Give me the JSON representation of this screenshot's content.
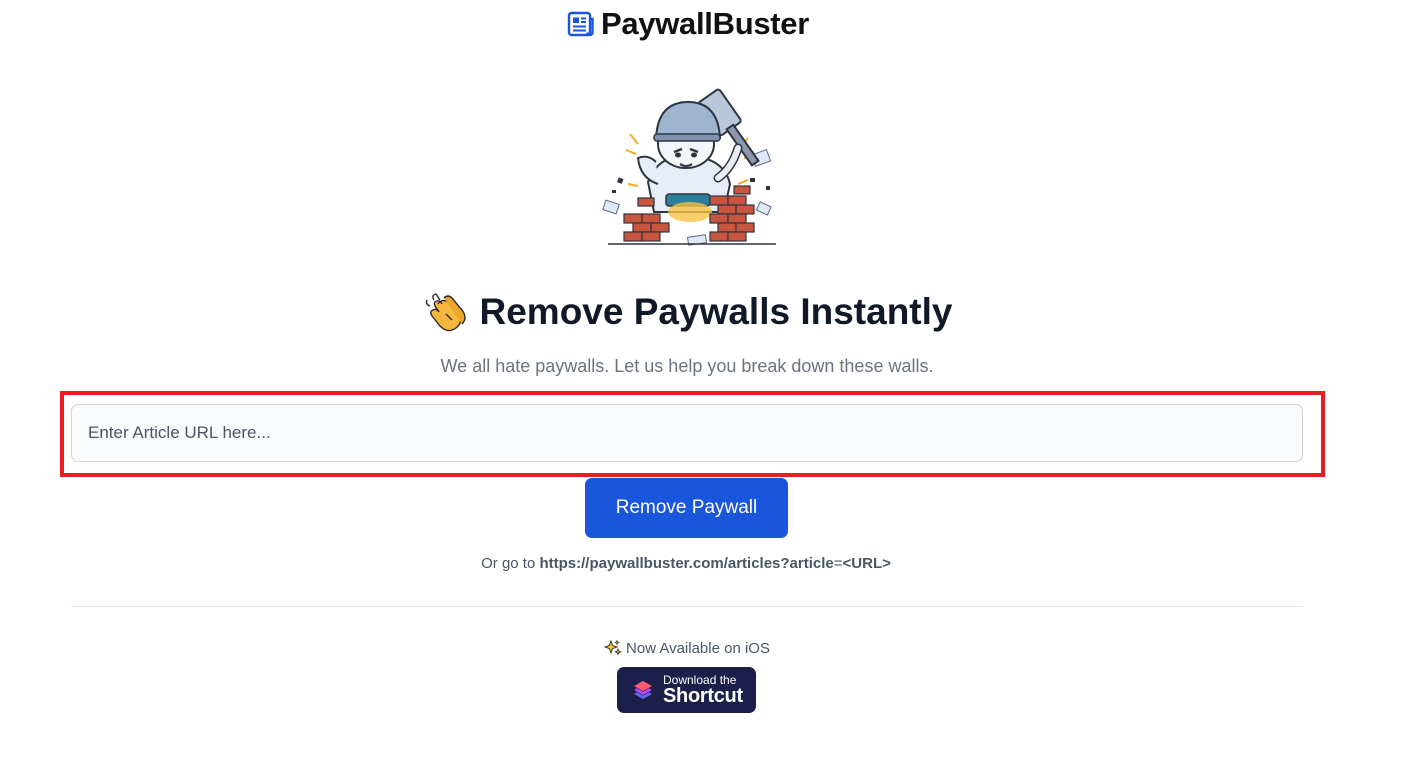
{
  "brand": {
    "name": "PaywallBuster",
    "icon": "newspaper-icon",
    "accent_color": "#1a56db"
  },
  "illustration": {
    "icon": "hammer-worker-brick-wall-illustration"
  },
  "hero": {
    "emoji_icon": "clapping-hands-icon",
    "title": "Remove Paywalls Instantly",
    "subtitle": "We all hate paywalls. Let us help you break down these walls."
  },
  "form": {
    "url_input_placeholder": "Enter Article URL here...",
    "url_input_value": "",
    "submit_label": "Remove Paywall",
    "highlight_color": "#ec1c24"
  },
  "alt_link": {
    "prefix": "Or go to",
    "url": "https://paywallbuster.com/articles?article",
    "equals": "=",
    "param": "<URL>"
  },
  "ios": {
    "icon": "sparkles-icon",
    "label": "Now Available on iOS",
    "badge_small": "Download the",
    "badge_big": "Shortcut",
    "badge_color": "#1c1f4a"
  }
}
